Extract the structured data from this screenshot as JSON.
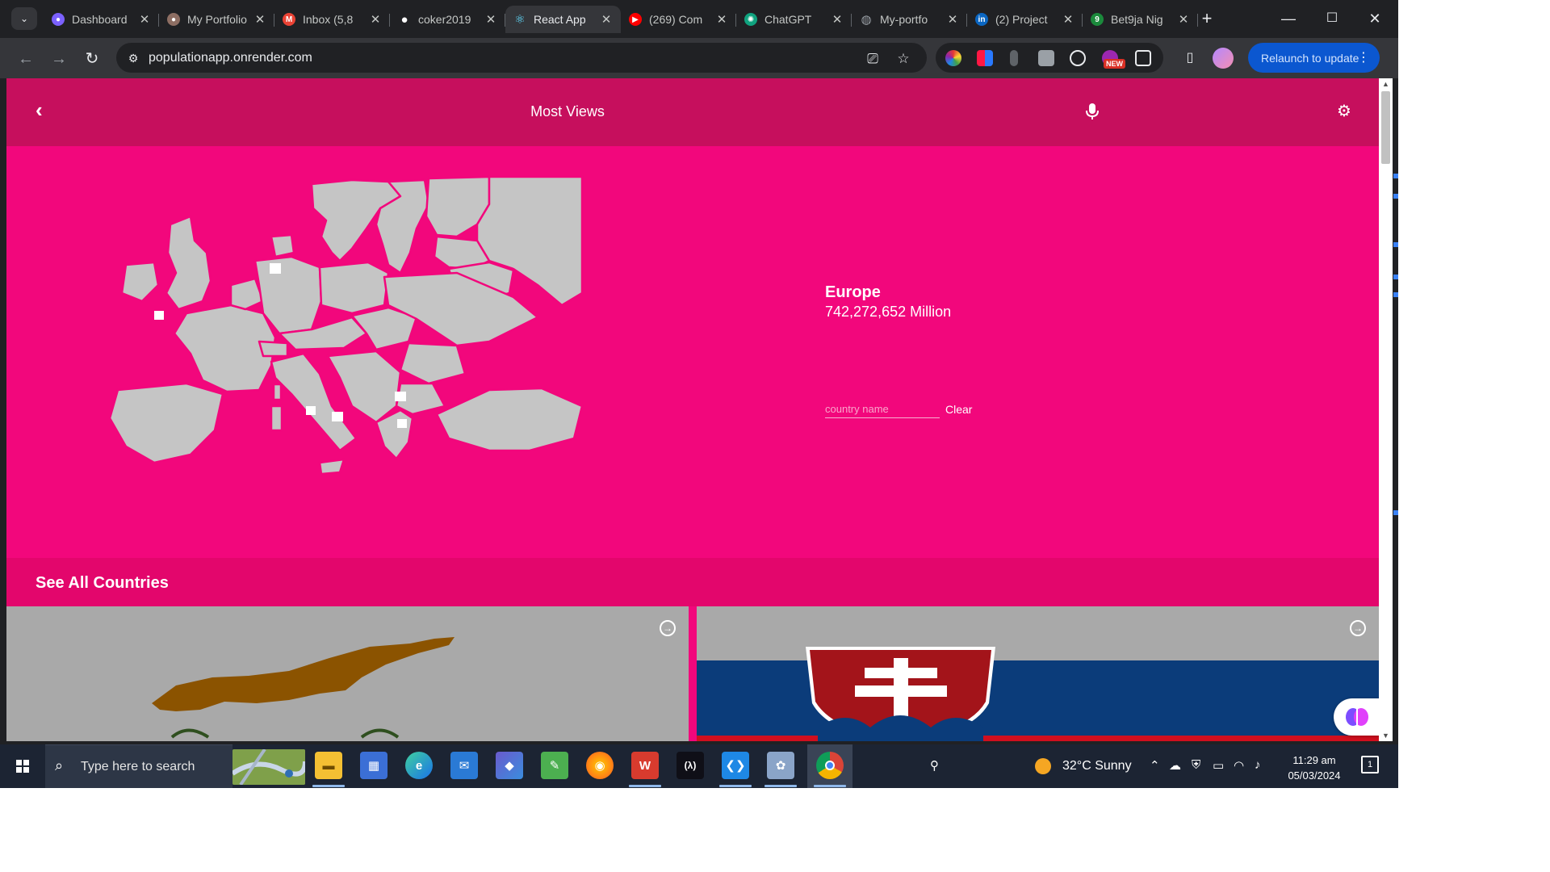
{
  "browser": {
    "tabs": [
      {
        "title": "Dashboard",
        "favicon": "dashboard-icon",
        "color": "#7b61ff",
        "glyph": "●"
      },
      {
        "title": "My Portfolio",
        "favicon": "portfolio-avatar-icon",
        "color": "#8d6e63",
        "glyph": "●"
      },
      {
        "title": "Inbox (5,8",
        "favicon": "gmail-icon",
        "color": "#ea4335",
        "glyph": "M"
      },
      {
        "title": "coker2019",
        "favicon": "github-icon",
        "color": "#ffffff",
        "glyph": "●"
      },
      {
        "title": "React App",
        "favicon": "react-icon",
        "color": "#61dafb",
        "glyph": "⚛"
      },
      {
        "title": "(269) Com",
        "favicon": "youtube-icon",
        "color": "#ff0000",
        "glyph": "▶"
      },
      {
        "title": "ChatGPT",
        "favicon": "chatgpt-icon",
        "color": "#10a37f",
        "glyph": "✺"
      },
      {
        "title": "My-portfo",
        "favicon": "globe-icon",
        "color": "#9aa0a6",
        "glyph": "◍"
      },
      {
        "title": "(2) Project",
        "favicon": "linkedin-icon",
        "color": "#0a66c2",
        "glyph": "in"
      },
      {
        "title": "Bet9ja Nig",
        "favicon": "bet9ja-icon",
        "color": "#1b8a3c",
        "glyph": "9"
      }
    ],
    "active_tab_index": 4,
    "url": "populationapp.onrender.com",
    "relaunch_label": "Relaunch to update",
    "new_badge": "NEW"
  },
  "app": {
    "header_title": "Most Views",
    "continent_name": "Europe",
    "continent_population": "742,272,652 Million",
    "search_placeholder": "country name",
    "clear_label": "Clear",
    "see_all_label": "See All Countries",
    "cards": [
      {
        "country_flag": "cyprus-flag"
      },
      {
        "country_flag": "slovakia-flag"
      }
    ],
    "colors": {
      "header": "#c60f5d",
      "hero": "#f2077c",
      "section_bar": "#e3066c",
      "map_land": "#c5c5c5",
      "card_bg": "#a9a9a9"
    }
  },
  "taskbar": {
    "search_placeholder": "Type here to search",
    "weather": "32°C  Sunny",
    "time": "11:29 am",
    "date": "05/03/2024",
    "notification_count": "1"
  }
}
